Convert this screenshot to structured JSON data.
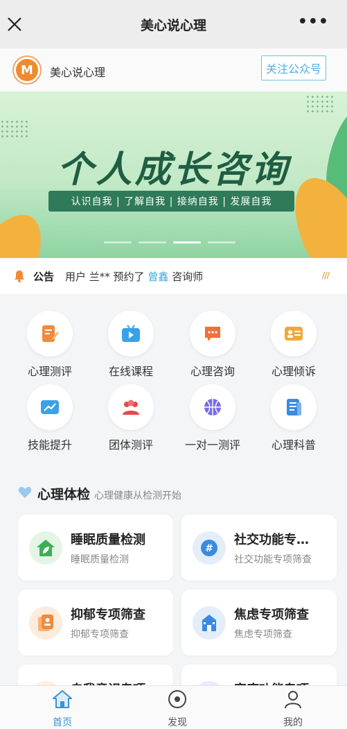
{
  "topbar": {
    "title": "美心说心理",
    "more": "•••"
  },
  "account": {
    "logo_letter": "M",
    "name": "美心说心理",
    "follow_label": "关注公众号"
  },
  "banner": {
    "headline": "个人成长咨询",
    "tagline": "认识自我 | 了解自我 | 接纳自我 | 发展自我",
    "slide_count": 4,
    "active_slide": 3
  },
  "notice": {
    "tag": "公告",
    "prefix": "用户 兰** 预约了",
    "highlight": "曾鑫",
    "suffix": "咨询师",
    "marker": "///"
  },
  "grid": {
    "items": [
      {
        "label": "心理测评",
        "icon": "test-edit-icon",
        "color": "#f08a3c"
      },
      {
        "label": "在线课程",
        "icon": "video-tv-icon",
        "color": "#3aa0e8"
      },
      {
        "label": "心理咨询",
        "icon": "chat-bubble-icon",
        "color": "#f0703c"
      },
      {
        "label": "心理倾诉",
        "icon": "contact-card-icon",
        "color": "#f0a83c"
      },
      {
        "label": "技能提升",
        "icon": "trend-chart-icon",
        "color": "#3aa0e8"
      },
      {
        "label": "团体测评",
        "icon": "group-people-icon",
        "color": "#e84a4a"
      },
      {
        "label": "一对一测评",
        "icon": "ball-icon",
        "color": "#7a6ee0"
      },
      {
        "label": "心理科普",
        "icon": "document-icon",
        "color": "#3a8ae0"
      }
    ]
  },
  "section": {
    "title": "心理体检",
    "subtitle": "心理健康从检测开始"
  },
  "cards": [
    {
      "title": "睡眠质量检测",
      "subtitle": "睡眠质量检测",
      "icon": "home-leaf-icon",
      "color": "#3cb054",
      "bg": "#e4f5e6"
    },
    {
      "title": "社交功能专…",
      "subtitle": "社交功能专项筛查",
      "icon": "hashtag-icon",
      "color": "#3a8ae0",
      "bg": "#e3eefa"
    },
    {
      "title": "抑郁专项筛查",
      "subtitle": "抑郁专项筛查",
      "icon": "badge-card-icon",
      "color": "#f08a3c",
      "bg": "#fdecdc"
    },
    {
      "title": "焦虑专项筛查",
      "subtitle": "焦虑专项筛查",
      "icon": "school-building-icon",
      "color": "#3a8ae0",
      "bg": "#e3eefa"
    },
    {
      "title": "自我意识专项",
      "subtitle": "",
      "icon": "self-icon",
      "color": "#f0a83c",
      "bg": "#fdf0dc"
    },
    {
      "title": "家庭功能专项",
      "subtitle": "",
      "icon": "family-icon",
      "color": "#7a6ee0",
      "bg": "#ece9fa"
    }
  ],
  "tabs": [
    {
      "label": "首页",
      "icon": "home-icon",
      "active": true
    },
    {
      "label": "发现",
      "icon": "discover-icon",
      "active": false
    },
    {
      "label": "我的",
      "icon": "user-icon",
      "active": false
    }
  ]
}
